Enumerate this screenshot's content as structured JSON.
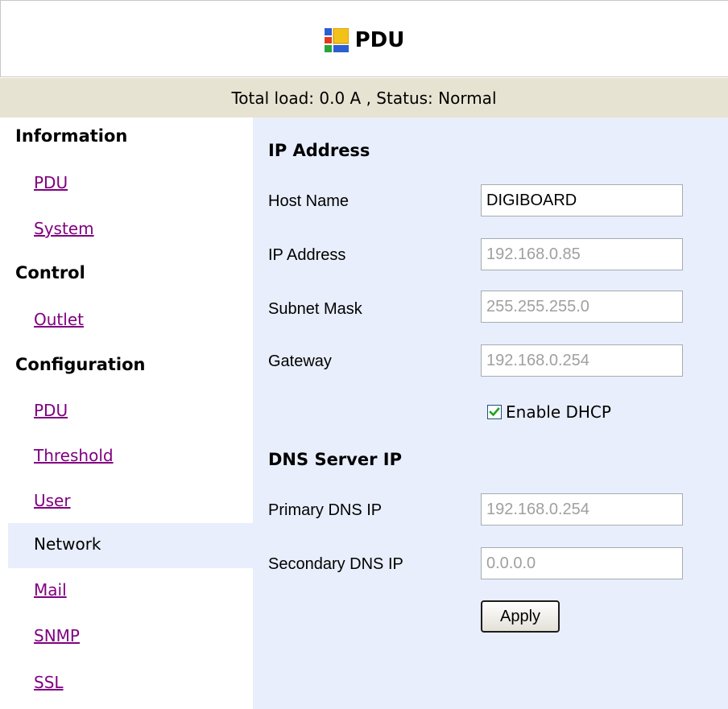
{
  "header": {
    "title": "PDU",
    "logo_icon": "windows-app-icon"
  },
  "status_bar": {
    "text": "Total load: 0.0 A , Status: Normal"
  },
  "sidebar": {
    "sections": [
      {
        "heading": "Information",
        "items": [
          "PDU",
          "System"
        ]
      },
      {
        "heading": "Control",
        "items": [
          "Outlet"
        ]
      },
      {
        "heading": "Configuration",
        "items": [
          "PDU",
          "Threshold",
          "User",
          "Network",
          "Mail",
          "SNMP",
          "SSL"
        ]
      }
    ],
    "current_item": "Network"
  },
  "form": {
    "ip_heading": "IP Address",
    "host_name": {
      "label": "Host Name",
      "value": "DIGIBOARD"
    },
    "ip_address": {
      "label": "IP Address",
      "value": "192.168.0.85"
    },
    "subnet_mask": {
      "label": "Subnet Mask",
      "value": "255.255.255.0"
    },
    "gateway": {
      "label": "Gateway",
      "value": "192.168.0.254"
    },
    "dhcp": {
      "label": "Enable DHCP",
      "checked": true
    },
    "dns_heading": "DNS Server IP",
    "primary_dns": {
      "label": "Primary DNS IP",
      "value": "192.168.0.254"
    },
    "secondary_dns": {
      "label": "Secondary DNS IP",
      "value": "0.0.0.0"
    },
    "apply_label": "Apply"
  },
  "colors": {
    "status_bar_bg": "#e7e3d2",
    "main_bg": "#e8eefb",
    "link": "#800080",
    "disabled_text": "#a0a0a0",
    "checkmark": "#21a121"
  }
}
